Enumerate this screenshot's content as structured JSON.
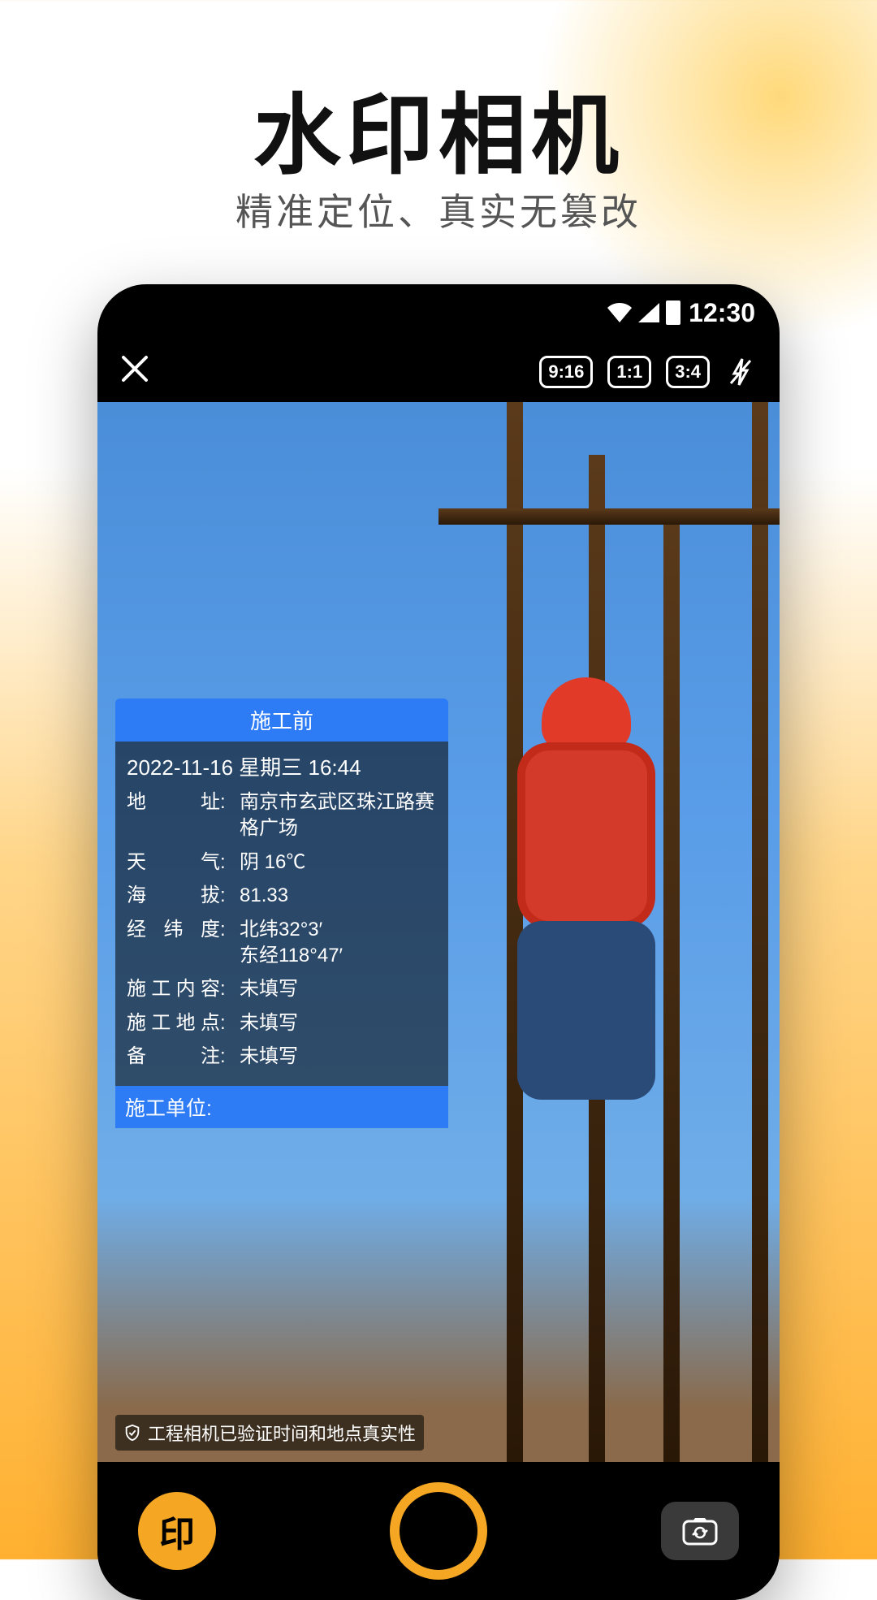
{
  "hero": {
    "title": "水印相机",
    "subtitle": "精准定位、真实无篡改"
  },
  "status": {
    "time": "12:30"
  },
  "topbar": {
    "ratio1": "9:16",
    "ratio2": "1:1",
    "ratio3": "3:4"
  },
  "watermark": {
    "title": "施工前",
    "datetime": "2022-11-16 星期三 16:44",
    "address_label": "地　　址",
    "address_value": "南京市玄武区珠江路赛格广场",
    "weather_label": "天　　气",
    "weather_value": "阴 16℃",
    "altitude_label": "海　　拔",
    "altitude_value": "81.33",
    "latlng_label": "经 纬 度",
    "latlng_value": "北纬32°3′\n东经118°47′",
    "content_label": "施工内容",
    "content_value": "未填写",
    "place_label": "施工地点",
    "place_value": "未填写",
    "note_label": "备　　注",
    "note_value": "未填写",
    "unit_label": "施工单位:"
  },
  "verify": {
    "text": "工程相机已验证时间和地点真实性"
  },
  "bottom": {
    "stamp_label": "印"
  }
}
